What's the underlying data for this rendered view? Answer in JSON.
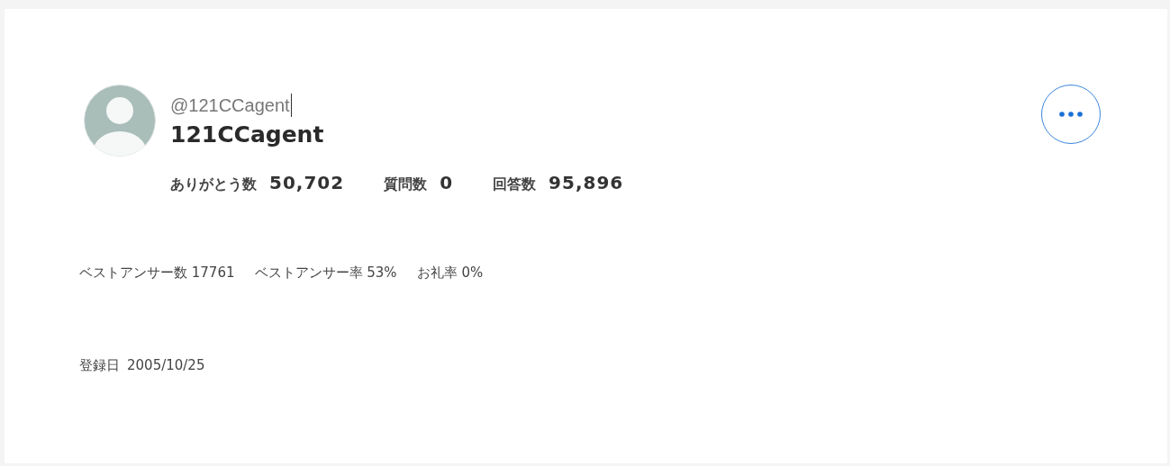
{
  "profile": {
    "handle": "@121CCagent",
    "name": "121CCagent"
  },
  "stats": [
    {
      "label": "ありがとう数",
      "value": "50,702"
    },
    {
      "label": "質問数",
      "value": "0"
    },
    {
      "label": "回答数",
      "value": "95,896"
    }
  ],
  "details": [
    "ベストアンサー数 17761",
    "ベストアンサー率 53%",
    "お礼率 0%"
  ],
  "registered": {
    "label": "登録日",
    "value": "2005/10/25"
  }
}
